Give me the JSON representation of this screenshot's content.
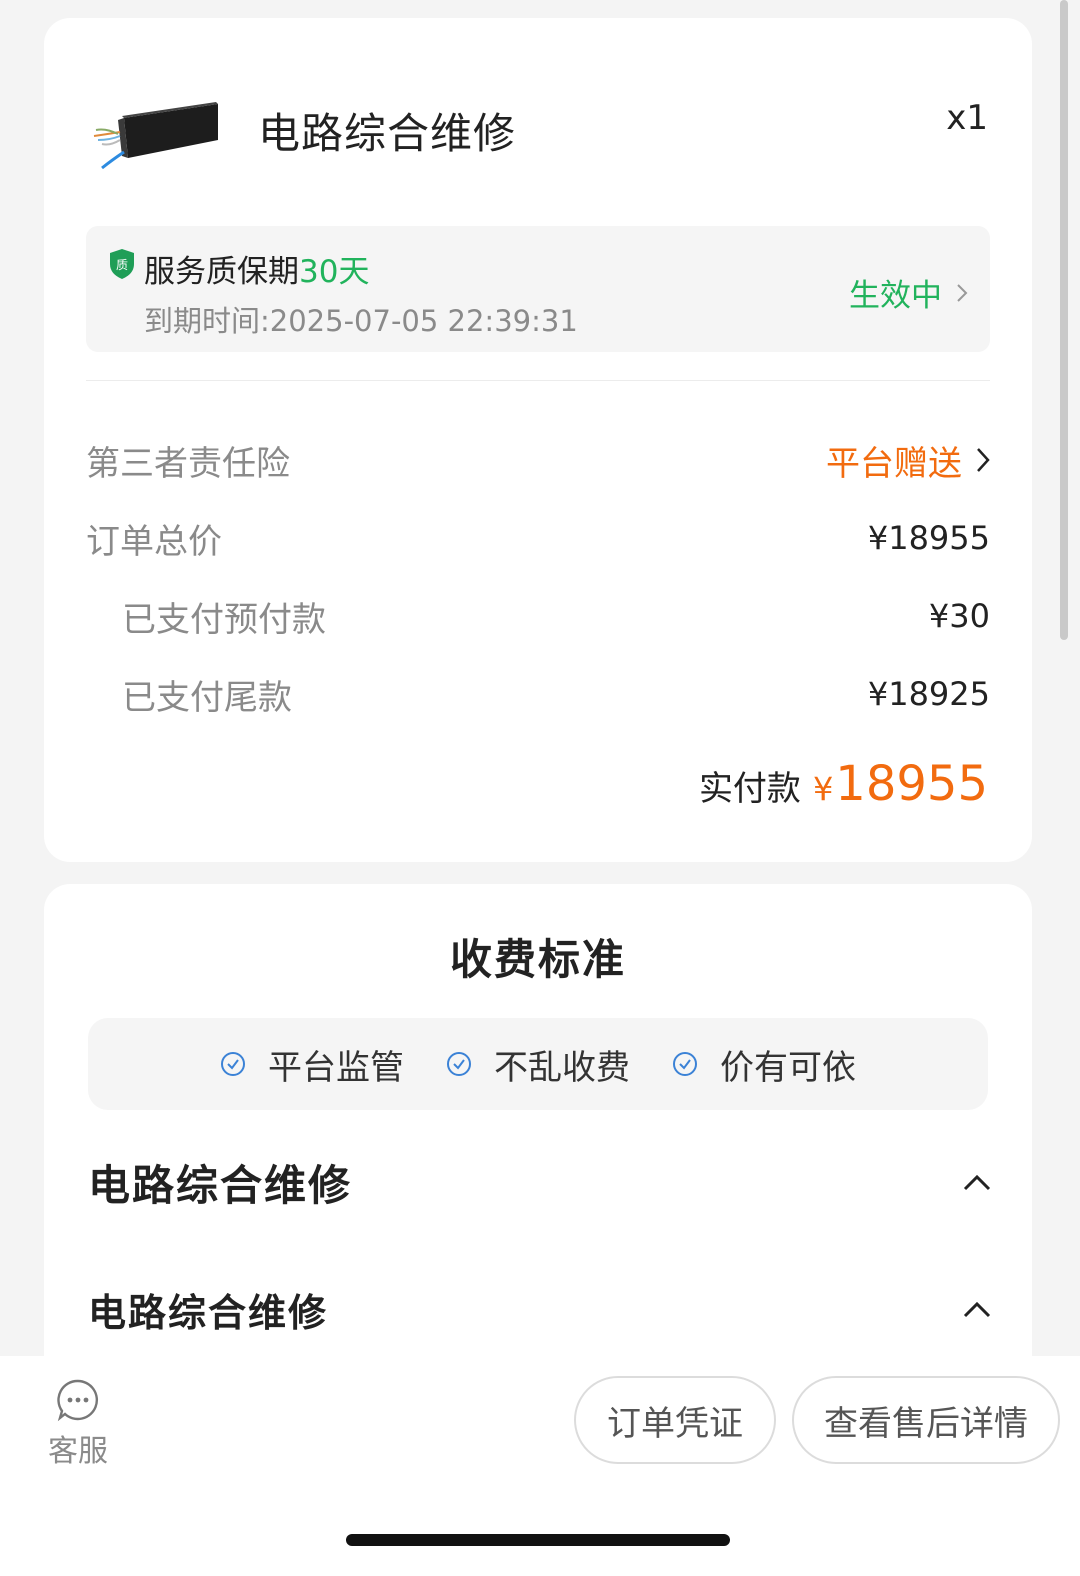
{
  "order_item": {
    "title": "电路综合维修",
    "quantity": "x1",
    "image_icon": "cable-product-icon"
  },
  "warranty": {
    "title_prefix": "服务质保期",
    "title_days": "30天",
    "expire_text": "到期时间:2025-07-05 22:39:31",
    "status": "生效中",
    "badge_icon": "quality-shield-icon",
    "accent_color": "#21b35c"
  },
  "price": {
    "insurance_label": "第三者责任险",
    "insurance_value": "平台赠送",
    "total_label": "订单总价",
    "total_value": "¥18955",
    "prepaid_label": "已支付预付款",
    "prepaid_value": "¥30",
    "final_label": "已支付尾款",
    "final_value": "¥18925",
    "actual_label": "实付款",
    "actual_currency": "¥",
    "actual_value": "18955",
    "accent_color": "#f26b0f"
  },
  "fee_standard": {
    "title": "收费标准",
    "promises": [
      "平台监管",
      "不乱收费",
      "价有可依"
    ],
    "sections": [
      "电路综合维修",
      "电路综合维修"
    ]
  },
  "bottom": {
    "service_label": "客服",
    "voucher_button": "订单凭证",
    "aftersale_button": "查看售后详情"
  }
}
